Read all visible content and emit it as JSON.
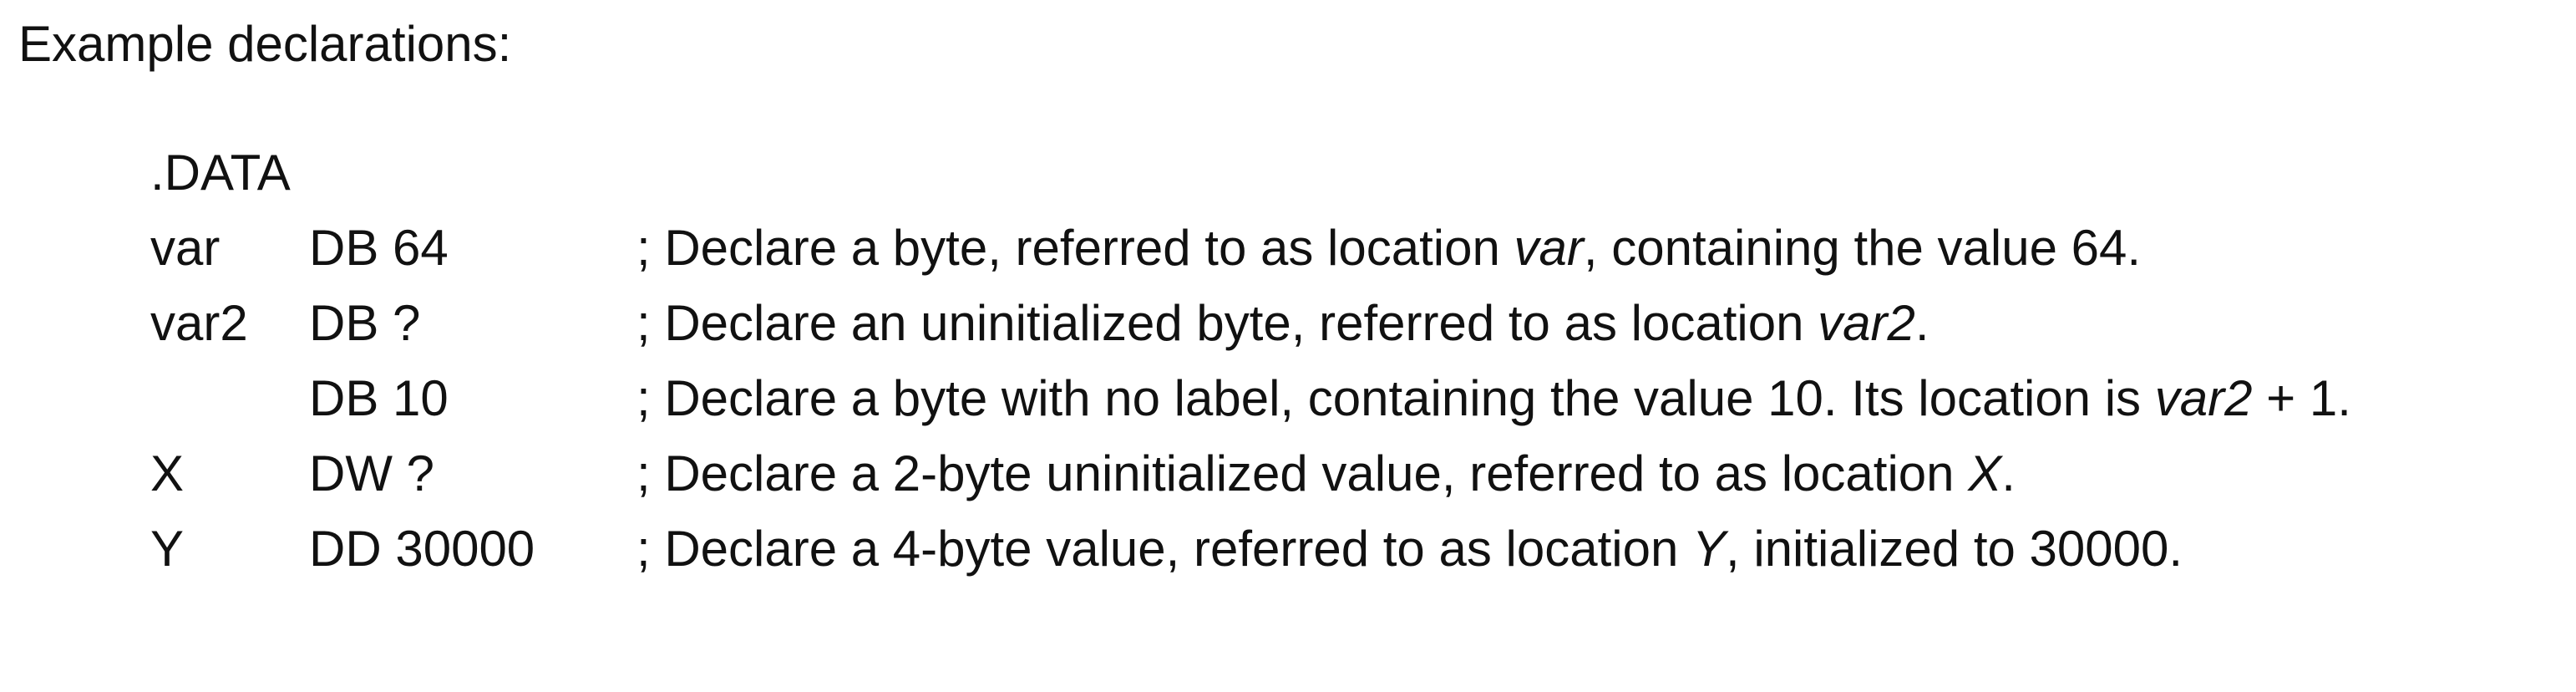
{
  "heading": "Example declarations:",
  "directive": ".DATA",
  "rows": [
    {
      "label": "var",
      "op": "DB 64",
      "comment_pre": "; Declare a byte, referred to as location ",
      "comment_em": "var",
      "comment_post": ", containing the value 64."
    },
    {
      "label": "var2",
      "op": "DB ?",
      "comment_pre": "; Declare an uninitialized byte, referred to as location ",
      "comment_em": "var2",
      "comment_post": "."
    },
    {
      "label": "",
      "op": "DB 10",
      "comment_pre": "; Declare a byte with no label, containing the value 10. Its location is ",
      "comment_em": "var2",
      "comment_post": " + 1."
    },
    {
      "label": "X",
      "op": "DW ?",
      "comment_pre": "; Declare a 2-byte uninitialized value, referred to as location ",
      "comment_em": "X",
      "comment_post": "."
    },
    {
      "label": "Y",
      "op": "DD 30000",
      "comment_pre": "; Declare a 4-byte value, referred to as location ",
      "comment_em": "Y",
      "comment_post": ", initialized to 30000."
    }
  ]
}
